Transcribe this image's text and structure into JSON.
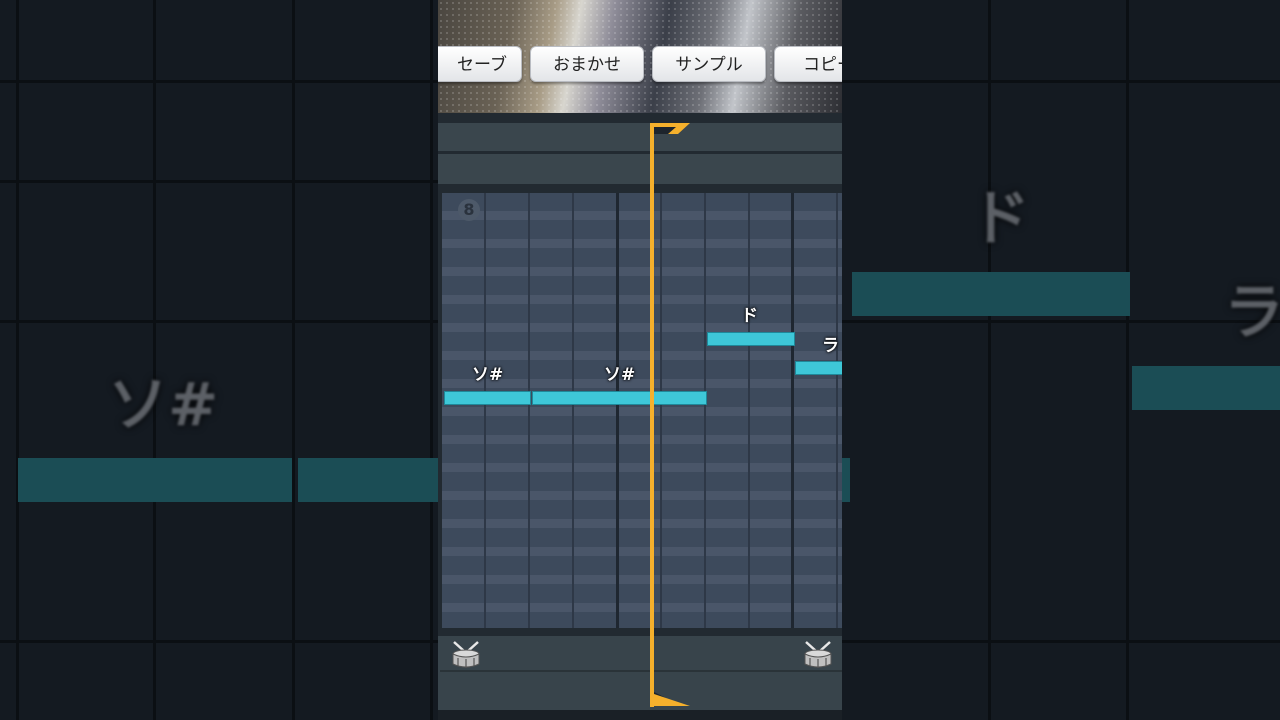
{
  "toolbar": {
    "buttons": [
      {
        "label": "セーブ"
      },
      {
        "label": "おまかせ"
      },
      {
        "label": "サンプル"
      },
      {
        "label": "コピー"
      }
    ]
  },
  "piano_roll": {
    "measure_number": "8",
    "notes": [
      {
        "label": "ソ#"
      },
      {
        "label": "ソ#"
      },
      {
        "label": "ド"
      },
      {
        "label": "ラ"
      }
    ]
  },
  "side_mirror": {
    "left_label": "ソ#",
    "right_label_1": "ド",
    "right_label_2": "ラ"
  },
  "colors": {
    "note": "#3ec7d8",
    "playhead": "#f5b02c",
    "grid": "#3d4a5c"
  },
  "icons": {
    "drum": "snare-drum-icon"
  }
}
